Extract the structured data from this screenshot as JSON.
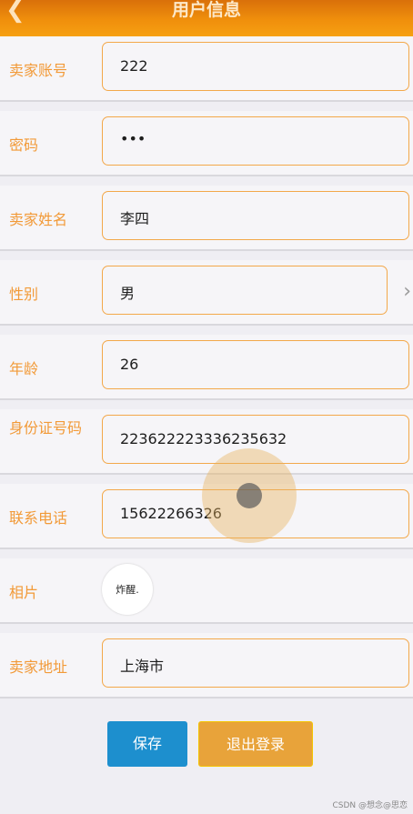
{
  "header": {
    "title": "用户信息",
    "back_icon": "chevron-left-icon"
  },
  "fields": [
    {
      "label": "卖家账号",
      "value": "222"
    },
    {
      "label": "密码",
      "value": "•••"
    },
    {
      "label": "卖家姓名",
      "value": "李四"
    },
    {
      "label": "性别",
      "value": "男"
    },
    {
      "label": "年龄",
      "value": "26"
    },
    {
      "label": "身份证号码",
      "value": "223622223336235632"
    },
    {
      "label": "联系电话",
      "value": "15622266326"
    },
    {
      "label": "相片",
      "value": ""
    },
    {
      "label": "卖家地址",
      "value": "上海市"
    }
  ],
  "avatar": {
    "signature": "炸醒."
  },
  "buttons": {
    "save": "保存",
    "logout": "退出登录"
  },
  "watermark": "CSDN @想念@思恋",
  "colors": {
    "accent": "#f08f0c",
    "label": "#f29a38",
    "save": "#1d8fce",
    "logout": "#e8a33a"
  }
}
